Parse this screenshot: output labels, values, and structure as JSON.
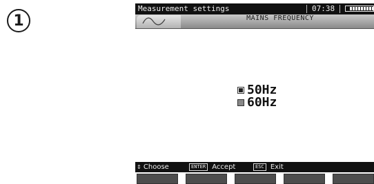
{
  "step": {
    "number": "1"
  },
  "status_bar": {
    "title": "Measurement settings",
    "time": "07:38",
    "battery_icon": "battery-icon"
  },
  "header": {
    "title": "MAINS FREQUENCY",
    "icon": "sine-wave-icon"
  },
  "options": [
    {
      "label": "50Hz",
      "checked": true
    },
    {
      "label": "60Hz",
      "checked": false
    }
  ],
  "bottom_bar": {
    "choose_label": "Choose",
    "accept_key": "ENTER",
    "accept_label": "Accept",
    "exit_key": "ESC",
    "exit_label": "Exit"
  }
}
